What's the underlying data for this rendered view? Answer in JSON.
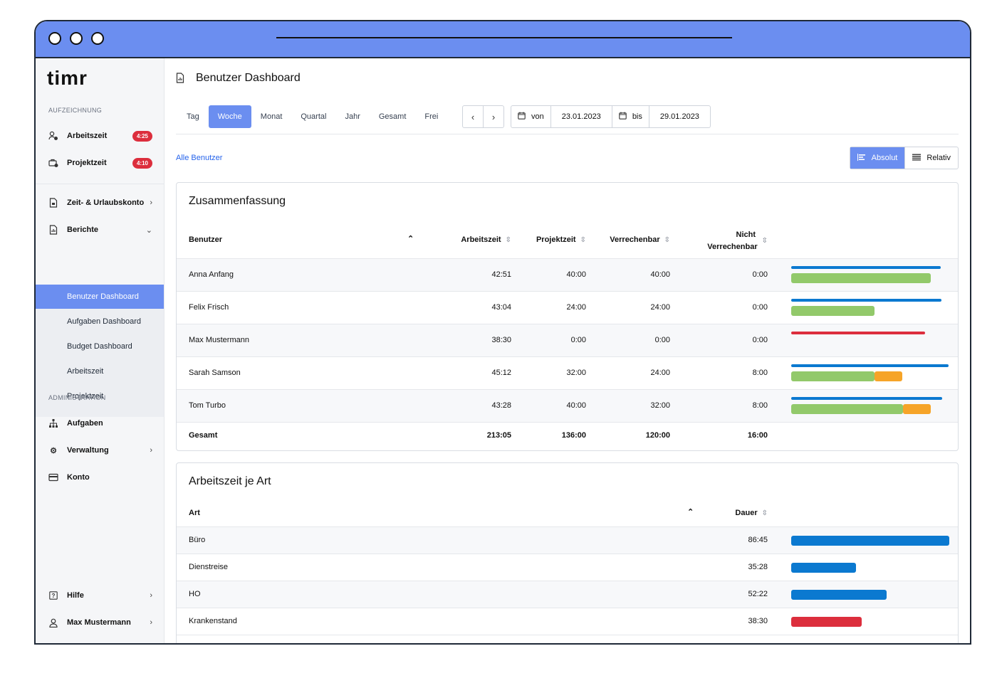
{
  "app": {
    "logo_text": "timr"
  },
  "colors": {
    "accent": "#6b8ef0",
    "blue": "#0b79d0",
    "green": "#92c96a",
    "orange": "#f6a428",
    "red": "#dc2e3d"
  },
  "sidebar": {
    "section_recording": "AUFZEICHNUNG",
    "arbeitszeit": {
      "label": "Arbeitszeit",
      "badge": "4:25"
    },
    "projektzeit": {
      "label": "Projektzeit",
      "badge": "4:10"
    },
    "zeitkonto": "Zeit- & Urlaubskonto",
    "berichte": "Berichte",
    "sub_items": [
      "Benutzer Dashboard",
      "Aufgaben Dashboard",
      "Budget Dashboard",
      "Arbeitszeit",
      "Projektzeit"
    ],
    "section_admin": "ADMINISTRATION",
    "aufgaben": "Aufgaben",
    "verwaltung": "Verwaltung",
    "konto": "Konto",
    "hilfe": "Hilfe",
    "user": "Max Mustermann"
  },
  "header": {
    "title": "Benutzer Dashboard"
  },
  "tabs": [
    "Tag",
    "Woche",
    "Monat",
    "Quartal",
    "Jahr",
    "Gesamt",
    "Frei"
  ],
  "active_tab": "Woche",
  "date": {
    "from_label": "von",
    "from": "23.01.2023",
    "to_label": "bis",
    "to": "29.01.2023"
  },
  "filter": {
    "all_users": "Alle Benutzer"
  },
  "view_toggle": {
    "absolute": "Absolut",
    "relative": "Relativ"
  },
  "summary": {
    "title": "Zusammenfassung",
    "headers": {
      "user": "Benutzer",
      "arbeitszeit": "Arbeitszeit",
      "projektzeit": "Projektzeit",
      "verrechenbar": "Verrechenbar",
      "nicht1": "Nicht",
      "nicht2": "Verrechenbar"
    },
    "rows": [
      {
        "name": "Anna Anfang",
        "arbeitszeit": "42:51",
        "projektzeit": "40:00",
        "verrechenbar": "40:00",
        "nicht": "0:00"
      },
      {
        "name": "Felix Frisch",
        "arbeitszeit": "43:04",
        "projektzeit": "24:00",
        "verrechenbar": "24:00",
        "nicht": "0:00"
      },
      {
        "name": "Max Mustermann",
        "arbeitszeit": "38:30",
        "projektzeit": "0:00",
        "verrechenbar": "0:00",
        "nicht": "0:00"
      },
      {
        "name": "Sarah Samson",
        "arbeitszeit": "45:12",
        "projektzeit": "32:00",
        "verrechenbar": "24:00",
        "nicht": "8:00"
      },
      {
        "name": "Tom Turbo",
        "arbeitszeit": "43:28",
        "projektzeit": "40:00",
        "verrechenbar": "32:00",
        "nicht": "8:00"
      }
    ],
    "total": {
      "name": "Gesamt",
      "arbeitszeit": "213:05",
      "projektzeit": "136:00",
      "verrechenbar": "120:00",
      "nicht": "16:00"
    }
  },
  "worktype": {
    "title": "Arbeitszeit je Art",
    "headers": {
      "art": "Art",
      "dauer": "Dauer"
    },
    "rows": [
      {
        "art": "Büro",
        "dauer": "86:45"
      },
      {
        "art": "Dienstreise",
        "dauer": "35:28"
      },
      {
        "art": "HO",
        "dauer": "52:22"
      },
      {
        "art": "Krankenstand",
        "dauer": "38:30"
      }
    ]
  }
}
